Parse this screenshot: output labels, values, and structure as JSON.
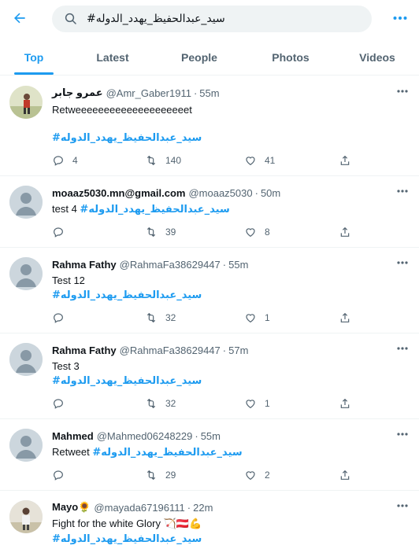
{
  "search": {
    "query": "#سيد_عبدالحفيظ_يهدد_الدوله"
  },
  "tabs": [
    "Top",
    "Latest",
    "People",
    "Photos",
    "Videos"
  ],
  "hashtag": "#سيد_عبدالحفيظ_يهدد_الدوله",
  "tweets": [
    {
      "name": "عمرو جابر",
      "handle": "@Amr_Gaber1911",
      "sep": "·",
      "time": "55m",
      "text": "Retweeeeeeeeeeeeeeeeeeeet",
      "replies": "4",
      "retweets": "140",
      "likes": "41"
    },
    {
      "name": "moaaz5030.mn@gmail.com",
      "handle": "@moaaz5030",
      "sep": "·",
      "time": "50m",
      "text": "test 4",
      "replies": "",
      "retweets": "39",
      "likes": "8"
    },
    {
      "name": "Rahma Fathy",
      "handle": "@RahmaFa38629447",
      "sep": "·",
      "time": "55m",
      "text": "Test 12",
      "replies": "",
      "retweets": "32",
      "likes": "1"
    },
    {
      "name": "Rahma Fathy",
      "handle": "@RahmaFa38629447",
      "sep": "·",
      "time": "57m",
      "text": "Test 3",
      "replies": "",
      "retweets": "32",
      "likes": "1"
    },
    {
      "name": "Mahmed",
      "handle": "@Mahmed06248229",
      "sep": "·",
      "time": "55m",
      "text": "Retweet",
      "replies": "",
      "retweets": "29",
      "likes": "2"
    },
    {
      "name": "Mayo🌻",
      "handle": "@mayada67196111",
      "sep": "·",
      "time": "22m",
      "text": "Fight for the white Glory 🏹🇦🇹💪"
    }
  ],
  "colors": {
    "accent": "#1d9bf0",
    "muted": "#536471",
    "divider": "#eff3f4",
    "avatar_default": "#ccd6dd"
  }
}
